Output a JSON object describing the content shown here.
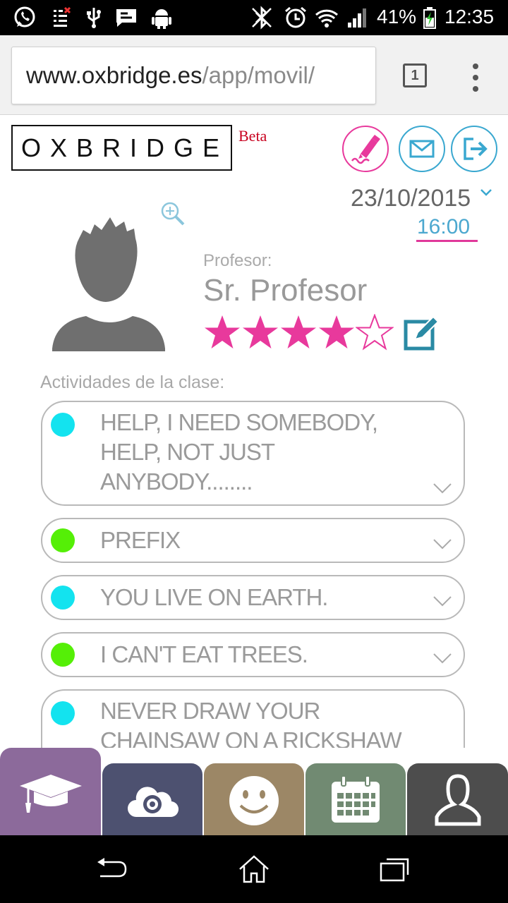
{
  "status_bar": {
    "battery": "41%",
    "time": "12:35",
    "icons": [
      "whatsapp-icon",
      "sim-icon",
      "usb-icon",
      "message-icon",
      "android-icon",
      "bluetooth-icon",
      "alarm-icon",
      "wifi-icon",
      "signal-icon",
      "battery-charging-icon"
    ]
  },
  "browser": {
    "url_host": "www.oxbridge.es",
    "url_path": "/app/movil/",
    "tab_count": "1"
  },
  "header": {
    "logo": "OXBRIDGE",
    "beta": "Beta",
    "buttons": [
      "pen-icon",
      "mail-icon",
      "logout-icon"
    ],
    "date": "23/10/2015",
    "time": "16:00"
  },
  "teacher": {
    "label": "Profesor:",
    "name": "Sr. Profesor",
    "rating": 4,
    "rating_max": 5
  },
  "activities": {
    "title": "Actividades de la clase:",
    "items": [
      {
        "text": "HELP, I NEED SOMEBODY, HELP, NOT JUST ANYBODY........",
        "color": "#13e3ef"
      },
      {
        "text": "PREFIX",
        "color": "#55ef07"
      },
      {
        "text": "YOU LIVE ON EARTH.",
        "color": "#13e3ef"
      },
      {
        "text": "I CAN'T EAT TREES.",
        "color": "#55ef07"
      },
      {
        "text": "NEVER DRAW YOUR CHAINSAW ON A RICKSHAW",
        "color": "#13e3ef"
      }
    ]
  },
  "tabs": [
    {
      "icon": "graduation-cap-icon",
      "color": "#8c6a9b"
    },
    {
      "icon": "cloud-eye-icon",
      "color": "#4d5170"
    },
    {
      "icon": "smiley-icon",
      "color": "#9c8766"
    },
    {
      "icon": "calendar-icon",
      "color": "#718a72"
    },
    {
      "icon": "user-icon",
      "color": "#4d4d4d"
    }
  ],
  "nav": [
    "back-icon",
    "home-icon",
    "recents-icon"
  ],
  "colors": {
    "pink": "#e8399c",
    "blue": "#3aa8d0"
  }
}
